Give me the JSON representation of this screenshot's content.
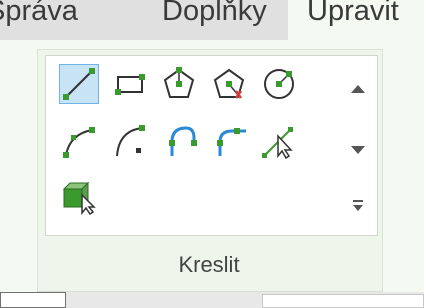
{
  "tabs": [
    {
      "label": "Správa"
    },
    {
      "label": "Doplňky"
    },
    {
      "label": "Upravit"
    }
  ],
  "panel": {
    "label": "Kreslit",
    "tools": [
      {
        "icon": "line-icon",
        "selected": true
      },
      {
        "icon": "rectangle-icon"
      },
      {
        "icon": "inscribed-polygon-icon"
      },
      {
        "icon": "circumscribed-polygon-icon"
      },
      {
        "icon": "circle-icon"
      },
      {
        "icon": "start-end-radius-arc-icon"
      },
      {
        "icon": "center-ends-arc-icon"
      },
      {
        "icon": "tangent-end-arc-icon"
      },
      {
        "icon": "fillet-arc-icon"
      },
      {
        "icon": "spline-icon"
      },
      {
        "icon": "pick-lines-icon"
      }
    ]
  },
  "colors": {
    "selected_tool_bg": "#c9e3f6",
    "icon_green": "#3a9a2e",
    "icon_blue": "#2a8ad6",
    "icon_red": "#d23c3c"
  }
}
